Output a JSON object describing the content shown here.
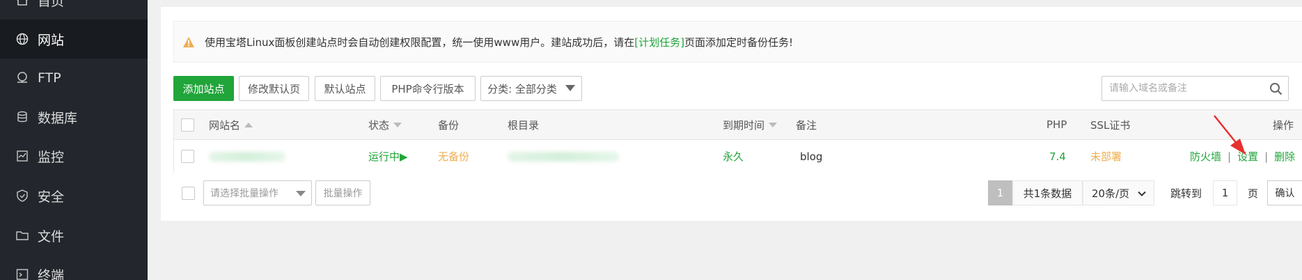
{
  "sidebar": {
    "items": [
      {
        "label": "首页",
        "icon": "home-icon"
      },
      {
        "label": "网站",
        "icon": "globe-icon"
      },
      {
        "label": "FTP",
        "icon": "ftp-icon"
      },
      {
        "label": "数据库",
        "icon": "database-icon"
      },
      {
        "label": "监控",
        "icon": "monitor-icon"
      },
      {
        "label": "安全",
        "icon": "shield-icon"
      },
      {
        "label": "文件",
        "icon": "folder-icon"
      },
      {
        "label": "终端",
        "icon": "terminal-icon"
      }
    ],
    "active": "网站"
  },
  "alert": {
    "text_before": "使用宝塔Linux面板创建站点时会自动创建权限配置，统一使用www用户。建站成功后，请在",
    "link": "[计划任务]",
    "text_after": "页面添加定时备份任务!"
  },
  "toolbar": {
    "add_site": "添加站点",
    "edit_default_page": "修改默认页",
    "default_site": "默认站点",
    "php_cli_version": "PHP命令行版本",
    "category": "分类: 全部分类"
  },
  "search": {
    "placeholder": "请输入域名或备注"
  },
  "table": {
    "headers": {
      "name": "网站名",
      "status": "状态",
      "backup": "备份",
      "root": "根目录",
      "expire": "到期时间",
      "remark": "备注",
      "php": "PHP",
      "ssl": "SSL证书",
      "actions": "操作"
    },
    "rows": [
      {
        "status": "运行中▶",
        "backup": "无备份",
        "expire": "永久",
        "remark": "blog",
        "php": "7.4",
        "ssl": "未部署",
        "actions": [
          "防火墙",
          "设置",
          "删除"
        ]
      }
    ]
  },
  "footer": {
    "batch_select_placeholder": "请选择批量操作",
    "batch_button": "批量操作"
  },
  "pagination": {
    "current_page": "1",
    "total": "共1条数据",
    "page_size": "20条/页",
    "jump_label": "跳转到",
    "jump_value": "1",
    "page_unit": "页",
    "confirm": "确认"
  },
  "colors": {
    "accent": "#20a53a",
    "warning": "#f0ad4e",
    "sidebar_bg": "#23272d",
    "annotation": "#e8302f"
  }
}
